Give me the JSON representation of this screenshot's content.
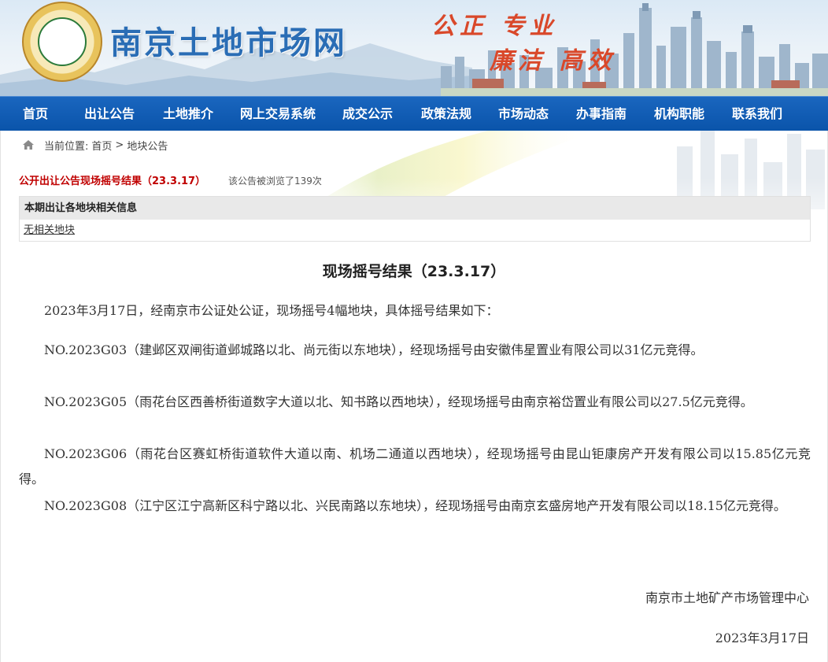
{
  "header": {
    "site_title": "南京土地市场网",
    "slogan_line1": "公正  专业",
    "slogan_line2": "廉洁  高效"
  },
  "nav": {
    "items": [
      "首页",
      "出让公告",
      "土地推介",
      "网上交易系统",
      "成交公示",
      "政策法规",
      "市场动态",
      "办事指南",
      "机构职能",
      "联系我们"
    ]
  },
  "breadcrumb": {
    "prefix": "当前位置:",
    "home": "首页",
    "separator": ">",
    "current": "地块公告"
  },
  "notice": {
    "title": "公开出让公告现场摇号结果（23.3.17）",
    "views": "该公告被浏览了139次"
  },
  "info_box": {
    "header": "本期出让各地块相关信息",
    "link": "无相关地块"
  },
  "article": {
    "title": "现场摇号结果（23.3.17）",
    "paragraphs": [
      "2023年3月17日，经南京市公证处公证，现场摇号4幅地块，具体摇号结果如下：",
      "NO.2023G03（建邺区双闸街道邺城路以北、尚元街以东地块），经现场摇号由安徽伟星置业有限公司以31亿元竞得。",
      "NO.2023G05（雨花台区西善桥街道数字大道以北、知书路以西地块），经现场摇号由南京裕岱置业有限公司以27.5亿元竞得。",
      "NO.2023G06（雨花台区赛虹桥街道软件大道以南、机场二通道以西地块），经现场摇号由昆山钜康房产开发有限公司以15.85亿元竞得。",
      "NO.2023G08（江宁区江宁高新区科宁路以北、兴民南路以东地块），经现场摇号由南京玄盛房地产开发有限公司以18.15亿元竞得。"
    ],
    "signature": "南京市土地矿产市场管理中心",
    "date": "2023年3月17日"
  },
  "colors": {
    "nav_bg": "#0a54aa",
    "title_blue": "#2a6db5",
    "slogan_red": "#d9482a",
    "notice_red": "#c00000"
  }
}
